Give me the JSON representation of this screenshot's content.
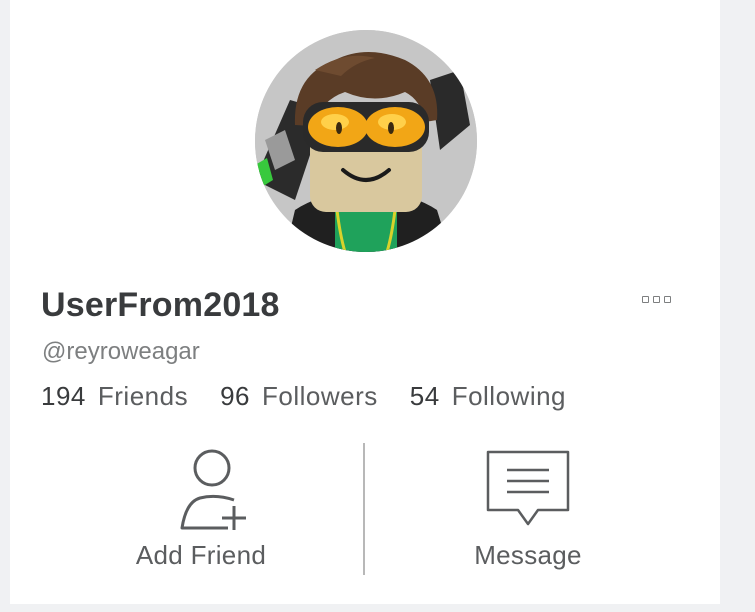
{
  "profile": {
    "display_name": "UserFrom2018",
    "username": "@reyroweagar",
    "avatar": "roblox-avatar-with-orange-goggles"
  },
  "stats": [
    {
      "count": "194",
      "label": "Friends"
    },
    {
      "count": "96",
      "label": "Followers"
    },
    {
      "count": "54",
      "label": "Following"
    }
  ],
  "actions": {
    "add_friend": {
      "label": "Add Friend",
      "icon": "add-friend-icon"
    },
    "message": {
      "label": "Message",
      "icon": "message-icon"
    }
  },
  "menu": {
    "icon": "more-options-icon"
  },
  "colors": {
    "text_primary": "#393b3d",
    "text_secondary": "#7d7f80",
    "background": "#ffffff",
    "page_background": "#f0f1f3"
  }
}
